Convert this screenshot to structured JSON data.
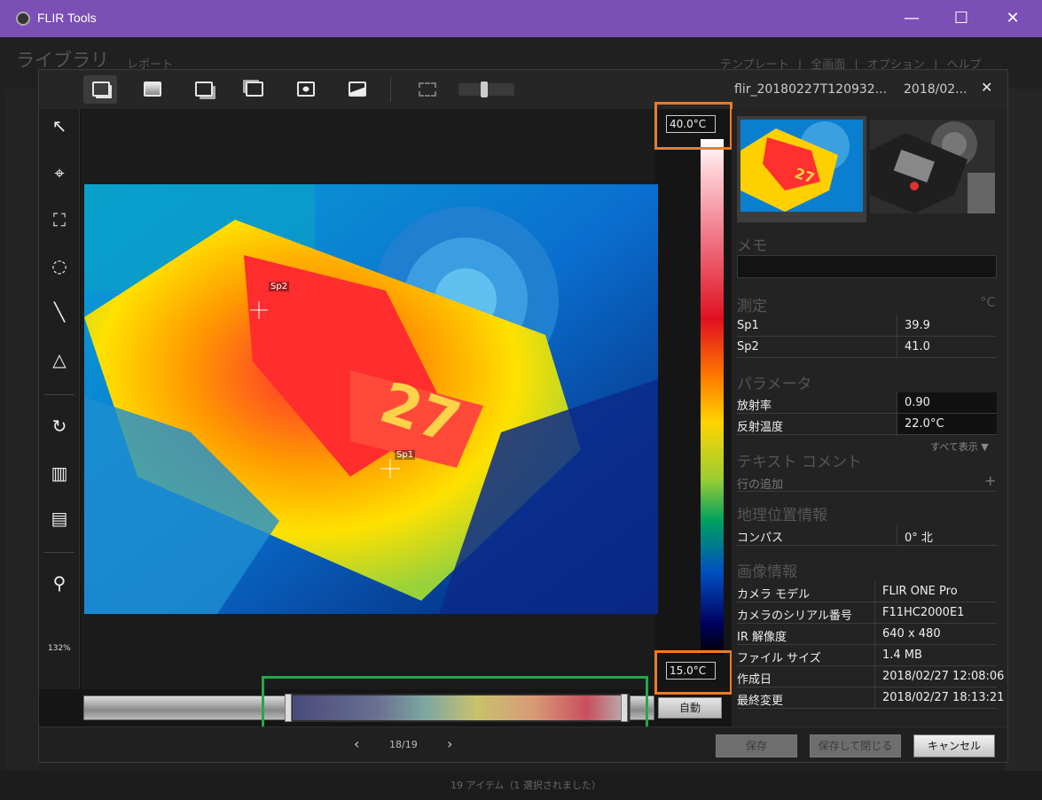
{
  "window": {
    "title": "FLIR Tools",
    "minimize": "—",
    "maximize": "☐",
    "close": "✕"
  },
  "background": {
    "nav_library": "ライブラリ",
    "nav_report": "レポート",
    "menu": "テンプレート | 全画面 | オプション | ヘルプ",
    "status": "19 アイテム（1 選択されました）"
  },
  "dialog": {
    "filename": "flir_20180227T120932...",
    "date": "2018/02...",
    "close": "✕",
    "zoom_level": 0.45,
    "toolbar_icons": [
      "single-view-icon",
      "ir-image-icon",
      "picture-in-picture-icon",
      "msx-blend-icon",
      "fusion-icon",
      "photo-icon",
      "fit-to-window-icon"
    ],
    "tools": {
      "select": "↖",
      "spot": "⌖",
      "box": "⛶",
      "circle": "◌",
      "line": "╲",
      "delta": "△",
      "rotate": "↻",
      "palette": "▥",
      "scale": "▤",
      "zoom": "⚲",
      "zoom_percent": "132%"
    },
    "scale": {
      "max": "40.0°C",
      "min": "15.0°C",
      "auto_button": "自動"
    },
    "spots": {
      "sp1": "Sp1",
      "sp2": "Sp2"
    },
    "nav": {
      "prev": "‹",
      "page": "18/19",
      "next": "›"
    },
    "buttons": {
      "save": "保存",
      "save_close": "保存して閉じる",
      "cancel": "キャンセル"
    }
  },
  "panel": {
    "memo_title": "メモ",
    "memo_value": "",
    "measure_title": "測定",
    "measure_unit": "°C",
    "measurements": [
      {
        "key": "Sp1",
        "value": "39.9"
      },
      {
        "key": "Sp2",
        "value": "41.0"
      }
    ],
    "params_title": "パラメータ",
    "params": [
      {
        "key": "放射率",
        "value": "0.90"
      },
      {
        "key": "反射温度",
        "value": "22.0°C"
      }
    ],
    "show_all": "すべて表示 ▼",
    "text_comment_title": "テキスト コメント",
    "add_row": "行の追加",
    "add_plus": "+",
    "geo_title": "地理位置情報",
    "geo": [
      {
        "key": "コンパス",
        "value": "0° 北"
      }
    ],
    "image_info_title": "画像情報",
    "image_info": [
      {
        "key": "カメラ モデル",
        "value": "FLIR ONE Pro"
      },
      {
        "key": "カメラのシリアル番号",
        "value": "F11HC2000E1"
      },
      {
        "key": "IR 解像度",
        "value": "640 x 480"
      },
      {
        "key": "ファイル サイズ",
        "value": "1.4 MB"
      },
      {
        "key": "作成日",
        "value": "2018/02/27 12:08:06"
      },
      {
        "key": "最終変更",
        "value": "2018/02/27 18:13:21"
      }
    ]
  },
  "colors": {
    "titlebar": "#7b4fb5",
    "highlight_orange": "#ef7a24",
    "highlight_green": "#24a84a"
  }
}
